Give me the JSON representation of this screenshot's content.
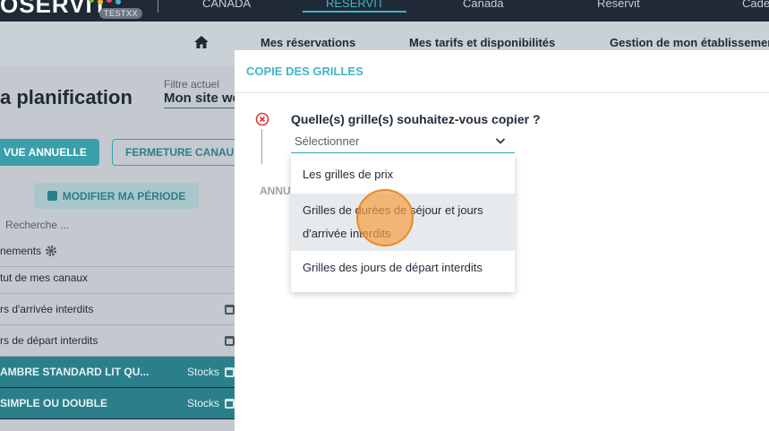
{
  "topbar": {
    "logo_text": "OSERVIT",
    "badge": "TESTXX",
    "links": [
      "CANADA",
      "RESERVIT",
      "Canada",
      "Reservit",
      "Cade"
    ]
  },
  "subnav": {
    "items": [
      "Mes réservations",
      "Mes tarifs et disponibilités",
      "Gestion de mon établissement"
    ]
  },
  "background": {
    "page_title": "a planification",
    "filter_label": "Filtre actuel",
    "filter_value": "Mon site web",
    "btn_annual": "VUE ANNUELLE",
    "btn_close_channels": "FERMETURE CANAUX",
    "btn_period": "MODIFIER MA PÉRIODE",
    "search_placeholder": "Recherche ...",
    "rows": [
      {
        "label": "nements"
      },
      {
        "label": "tut de mes canaux"
      },
      {
        "label": "rs d'arrivée interdits"
      },
      {
        "label": "rs de départ interdits"
      },
      {
        "label": "AMBRE STANDARD LIT QU...",
        "right": "Stocks"
      },
      {
        "label": "SIMPLE OU DOUBLE",
        "right": "Stocks"
      }
    ]
  },
  "modal": {
    "title": "COPIE DES GRILLES",
    "question": "Quelle(s) grille(s) souhaitez-vous copier ?",
    "select_value": "Sélectionner",
    "annul_label": "ANNU",
    "options": [
      {
        "label": "Les grilles de prix"
      },
      {
        "label_line1": "Grilles de durées de séjour et jours",
        "label_line2": "d'arrivée interdits"
      },
      {
        "label": "Grilles des jours de départ interdits"
      }
    ]
  },
  "colors": {
    "accent": "#3fb7c6",
    "dark_nav": "#1f2a36",
    "teal_row": "#2b7f8a",
    "error": "#d9363e"
  }
}
